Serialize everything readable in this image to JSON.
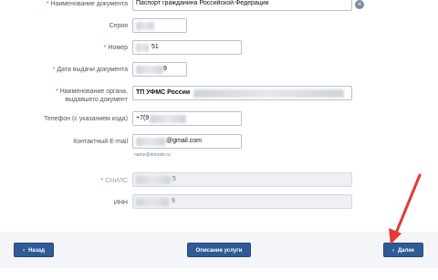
{
  "form": {
    "fields": [
      {
        "id": "doc_name",
        "label": "Наименование документа",
        "required": true,
        "value": "Паспорт гражданина Российской Федерации"
      },
      {
        "id": "series",
        "label": "Серия",
        "required": false,
        "value": ""
      },
      {
        "id": "number",
        "label": "Номер",
        "required": true,
        "value": "51"
      },
      {
        "id": "issue_date",
        "label": "Дата выдачи документа",
        "required": true,
        "value": "9"
      },
      {
        "id": "issuer",
        "label_line1": "Наименование органа,",
        "label_line2": "выдавшего документ",
        "required": true,
        "value": "ТП УФМС России"
      },
      {
        "id": "phone",
        "label": "Телефон (с указанием кода)",
        "required": false,
        "value": "+7(9"
      },
      {
        "id": "email",
        "label": "Контактный E-mail",
        "required": false,
        "value": "@gmail.com",
        "hint": "name@domain.ru"
      },
      {
        "id": "snils",
        "label": "СНИЛС",
        "required": true,
        "value": "5"
      },
      {
        "id": "inn",
        "label": "ИНН",
        "required": false,
        "value": "9"
      }
    ],
    "required_mark": "*",
    "clear_icon_glyph": "×"
  },
  "footer": {
    "back_label": "Назад",
    "service_desc_label": "Описание услуги",
    "next_label": "Далее",
    "chevron_left": "‹",
    "chevron_right": "›"
  },
  "colors": {
    "button_bg": "#2e5b96",
    "required_star": "#d9534f",
    "annotation_arrow": "#e53935"
  }
}
